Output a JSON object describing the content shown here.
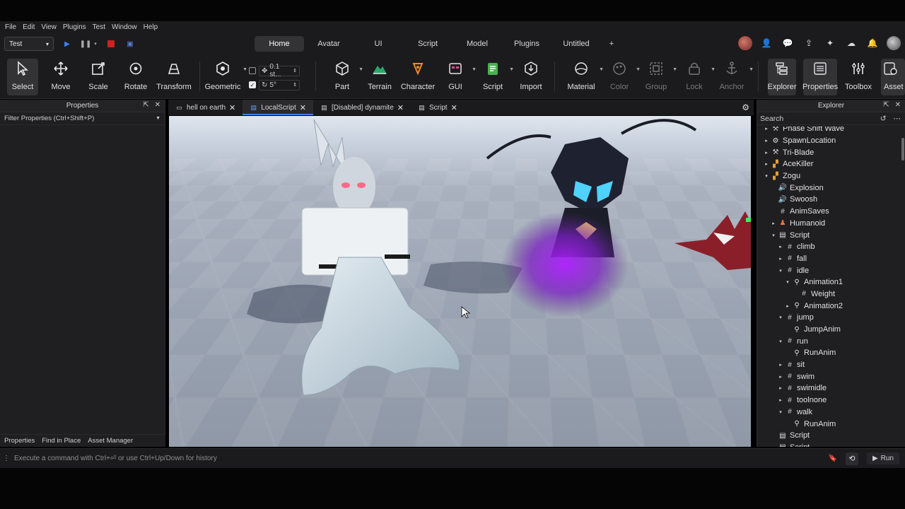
{
  "menubar": [
    "File",
    "Edit",
    "View",
    "Plugins",
    "Test",
    "Window",
    "Help"
  ],
  "topbar": {
    "place": "Test",
    "tabs": [
      "Home",
      "Avatar",
      "UI",
      "Script",
      "Model",
      "Plugins",
      "Untitled"
    ],
    "active_tab": "Home",
    "add_tab": "+"
  },
  "ribbon": {
    "select": "Select",
    "move": "Move",
    "scale": "Scale",
    "rotate": "Rotate",
    "transform": "Transform",
    "geometric": "Geometric",
    "move_snap": "0.1 st...",
    "rotate_snap": "5°",
    "part": "Part",
    "terrain": "Terrain",
    "character": "Character",
    "gui": "GUI",
    "script": "Script",
    "import": "Import",
    "material": "Material",
    "color": "Color",
    "group": "Group",
    "lock": "Lock",
    "anchor": "Anchor",
    "explorer": "Explorer",
    "properties": "Properties",
    "toolbox": "Toolbox",
    "asset": "Asset"
  },
  "properties_panel": {
    "title": "Properties",
    "filter_placeholder": "Filter Properties (Ctrl+Shift+P)",
    "footer_tabs": [
      "Properties",
      "Find in Place",
      "Asset Manager"
    ]
  },
  "doc_tabs": [
    {
      "label": "hell on earth",
      "active": false
    },
    {
      "label": "LocalScript",
      "active": true
    },
    {
      "label": "[Disabled] dynamite",
      "active": false
    },
    {
      "label": "Script",
      "active": false
    }
  ],
  "explorer": {
    "title": "Explorer",
    "search_placeholder": "Search",
    "nodes": [
      {
        "label": "Phase Shift Wave",
        "depth": 1,
        "arrow": "▸",
        "icon": "hammer"
      },
      {
        "label": "SpawnLocation",
        "depth": 1,
        "arrow": "▸",
        "icon": "gear"
      },
      {
        "label": "Tri-Blade",
        "depth": 1,
        "arrow": "▸",
        "icon": "hammer"
      },
      {
        "label": "AceKiller",
        "depth": 1,
        "arrow": "▸",
        "icon": "model"
      },
      {
        "label": "Zogu",
        "depth": 1,
        "arrow": "▾",
        "icon": "model"
      },
      {
        "label": "Explosion",
        "depth": 2,
        "arrow": "",
        "icon": "sound"
      },
      {
        "label": "Swoosh",
        "depth": 2,
        "arrow": "",
        "icon": "sound"
      },
      {
        "label": "AnimSaves",
        "depth": 2,
        "arrow": "",
        "icon": "hash"
      },
      {
        "label": "Humanoid",
        "depth": 2,
        "arrow": "▸",
        "icon": "humanoid"
      },
      {
        "label": "Script",
        "depth": 2,
        "arrow": "▾",
        "icon": "script"
      },
      {
        "label": "climb",
        "depth": 3,
        "arrow": "▸",
        "icon": "hash"
      },
      {
        "label": "fall",
        "depth": 3,
        "arrow": "▸",
        "icon": "hash"
      },
      {
        "label": "idle",
        "depth": 3,
        "arrow": "▾",
        "icon": "hash"
      },
      {
        "label": "Animation1",
        "depth": 4,
        "arrow": "▾",
        "icon": "anim"
      },
      {
        "label": "Weight",
        "depth": 5,
        "arrow": "",
        "icon": "hash"
      },
      {
        "label": "Animation2",
        "depth": 4,
        "arrow": "▸",
        "icon": "anim"
      },
      {
        "label": "jump",
        "depth": 3,
        "arrow": "▾",
        "icon": "hash"
      },
      {
        "label": "JumpAnim",
        "depth": 4,
        "arrow": "",
        "icon": "anim"
      },
      {
        "label": "run",
        "depth": 3,
        "arrow": "▾",
        "icon": "hash"
      },
      {
        "label": "RunAnim",
        "depth": 4,
        "arrow": "",
        "icon": "anim"
      },
      {
        "label": "sit",
        "depth": 3,
        "arrow": "▸",
        "icon": "hash"
      },
      {
        "label": "swim",
        "depth": 3,
        "arrow": "▸",
        "icon": "hash"
      },
      {
        "label": "swimidle",
        "depth": 3,
        "arrow": "▸",
        "icon": "hash"
      },
      {
        "label": "toolnone",
        "depth": 3,
        "arrow": "▸",
        "icon": "hash"
      },
      {
        "label": "walk",
        "depth": 3,
        "arrow": "▾",
        "icon": "hash"
      },
      {
        "label": "RunAnim",
        "depth": 4,
        "arrow": "",
        "icon": "anim"
      },
      {
        "label": "Script",
        "depth": 2,
        "arrow": "",
        "icon": "script"
      },
      {
        "label": "Script",
        "depth": 2,
        "arrow": "",
        "icon": "script"
      }
    ]
  },
  "command_bar": {
    "placeholder": "Execute a command with Ctrl+⏎ or use Ctrl+Up/Down for history",
    "run_label": "Run"
  },
  "colors": {
    "accent": "#3b82f6",
    "purple_smoke": "#8a2be2",
    "record_red": "#cc2222",
    "play_blue": "#3b82f6"
  }
}
